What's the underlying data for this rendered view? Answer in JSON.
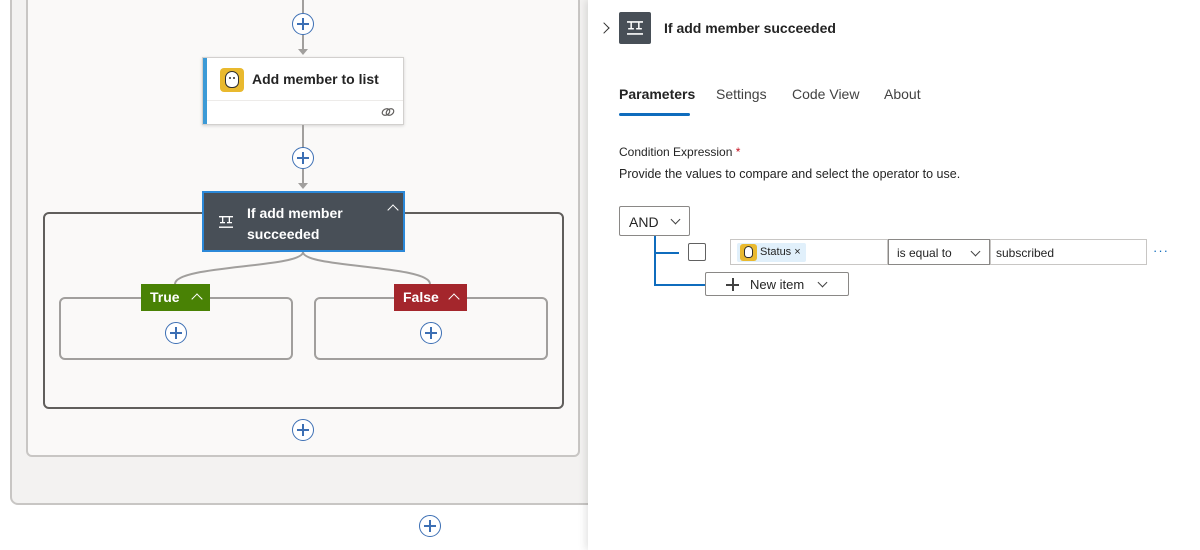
{
  "designer": {
    "action_card": {
      "title": "Add member to list",
      "icon": "mailchimp-icon",
      "accent": "#3c9ad6"
    },
    "condition_card": {
      "title": "If add member succeeded",
      "icon": "condition-icon"
    },
    "branches": {
      "true_label": "True",
      "false_label": "False",
      "true_color": "#498205",
      "false_color": "#a4262c"
    }
  },
  "panel": {
    "title": "If add member succeeded",
    "tabs": [
      "Parameters",
      "Settings",
      "Code View",
      "About"
    ],
    "active_tab": "Parameters",
    "field_label": "Condition Expression",
    "required_mark": "*",
    "field_description": "Provide the values to compare and select the operator to use.",
    "group_operator": "AND",
    "row": {
      "token_label": "Status",
      "token_remove": "×",
      "operator": "is equal to",
      "value": "subscribed",
      "more": "···"
    },
    "new_item_label": "New item"
  },
  "colors": {
    "accent": "#0f6cbd",
    "card_dark": "#484f57"
  }
}
